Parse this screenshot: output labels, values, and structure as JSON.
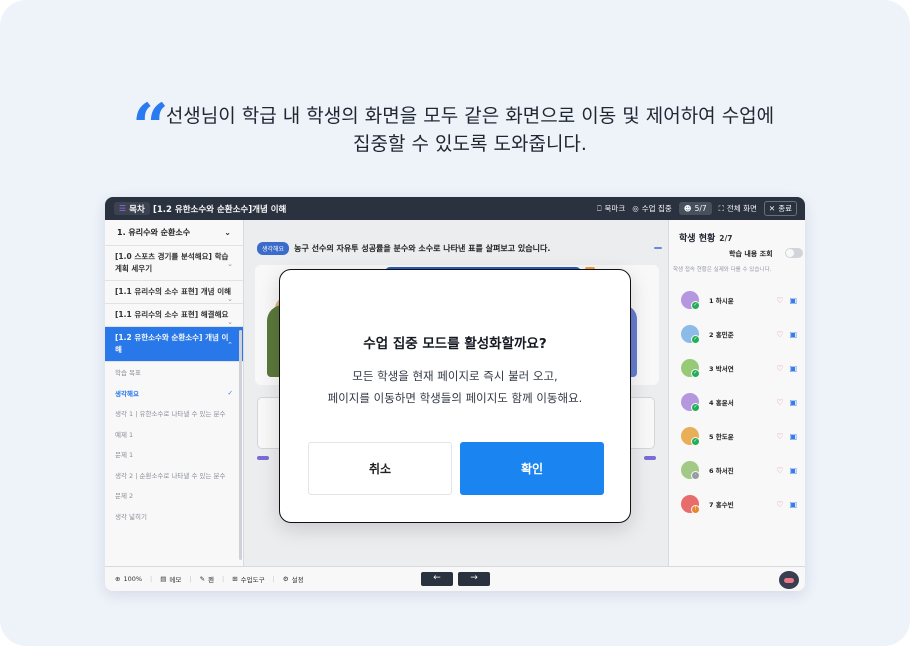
{
  "headline": {
    "line1": "선생님이 학급 내 학생의 화면을 모두 같은 화면으로 이동 및 제어하여 수업에",
    "line2": "집중할 수 있도록 도와줍니다."
  },
  "topbar": {
    "toc_label": "목차",
    "lesson_title": "[1.2 유한소수와 순환소수]개념 이해",
    "bookmark": "북마크",
    "focus_mode": "수업 집중",
    "student_count": "5/7",
    "fullscreen": "전체 화면",
    "end": "종료"
  },
  "sidebar": {
    "chapter": "1. 유리수와 순환소수",
    "lessons": [
      {
        "label": "[1.0 스포츠 경기를 분석해요] 학습 계획 세우기"
      },
      {
        "label": "[1.1 유리수의 소수 표현] 개념 이해"
      },
      {
        "label": "[1.1 유리수의 소수 표현] 해결해요"
      },
      {
        "label": "[1.2 유한소수와 순환소수] 개념 이해"
      }
    ],
    "steps": [
      {
        "label": "학습 목표"
      },
      {
        "label": "생각해요"
      },
      {
        "label": "생각 1 | 유한소수로 나타낼 수 있는 분수"
      },
      {
        "label": "예제 1"
      },
      {
        "label": "문제 1"
      },
      {
        "label": "생각 2 | 순환소수로 나타낼 수 있는 분수"
      },
      {
        "label": "문제 2"
      },
      {
        "label": "생각 넓히기"
      }
    ]
  },
  "content": {
    "chip": "생각해요",
    "prompt": "농구 선수의 자유투 성공률을 분수와 소수로 나타낸 표를 살펴보고 있습니다."
  },
  "panel": {
    "title": "학생 현황",
    "count": "2/7",
    "view_label": "학습 내용 조회",
    "help": "학생 접속 현황은 실제와 다를 수 있습니다.",
    "students": [
      {
        "name": "1 하시윤",
        "avatar_color": "#b99be6",
        "status_color": "#22b35a"
      },
      {
        "name": "2 홍민준",
        "avatar_color": "#8fc1ee",
        "status_color": "#22b35a"
      },
      {
        "name": "3 박서연",
        "avatar_color": "#9bd07a",
        "status_color": "#22b35a"
      },
      {
        "name": "4 홍윤서",
        "avatar_color": "#b99be6",
        "status_color": "#22b35a"
      },
      {
        "name": "5 한도윤",
        "avatar_color": "#f0b35a",
        "status_color": "#22b35a"
      },
      {
        "name": "6 하서진",
        "avatar_color": "#a7d08a",
        "status_color": "#9aa0a8"
      },
      {
        "name": "7 홍수빈",
        "avatar_color": "#ef6f6f",
        "status_color": "#f08a2c"
      }
    ]
  },
  "bottombar": {
    "zoom": "100%",
    "memo": "메모",
    "pen": "펜",
    "tools": "수업도구",
    "settings": "설정"
  },
  "modal": {
    "title": "수업 집중 모드를 활성화할까요?",
    "body1": "모든 학생을 현재 페이지로 즉시 불러 오고,",
    "body2": "페이지를 이동하면 학생들의 페이지도 함께 이동해요.",
    "cancel": "취소",
    "confirm": "확인"
  },
  "colors": {
    "accent": "#1a84f0",
    "background": "#eef2f9",
    "topbar": "#2c3340"
  }
}
